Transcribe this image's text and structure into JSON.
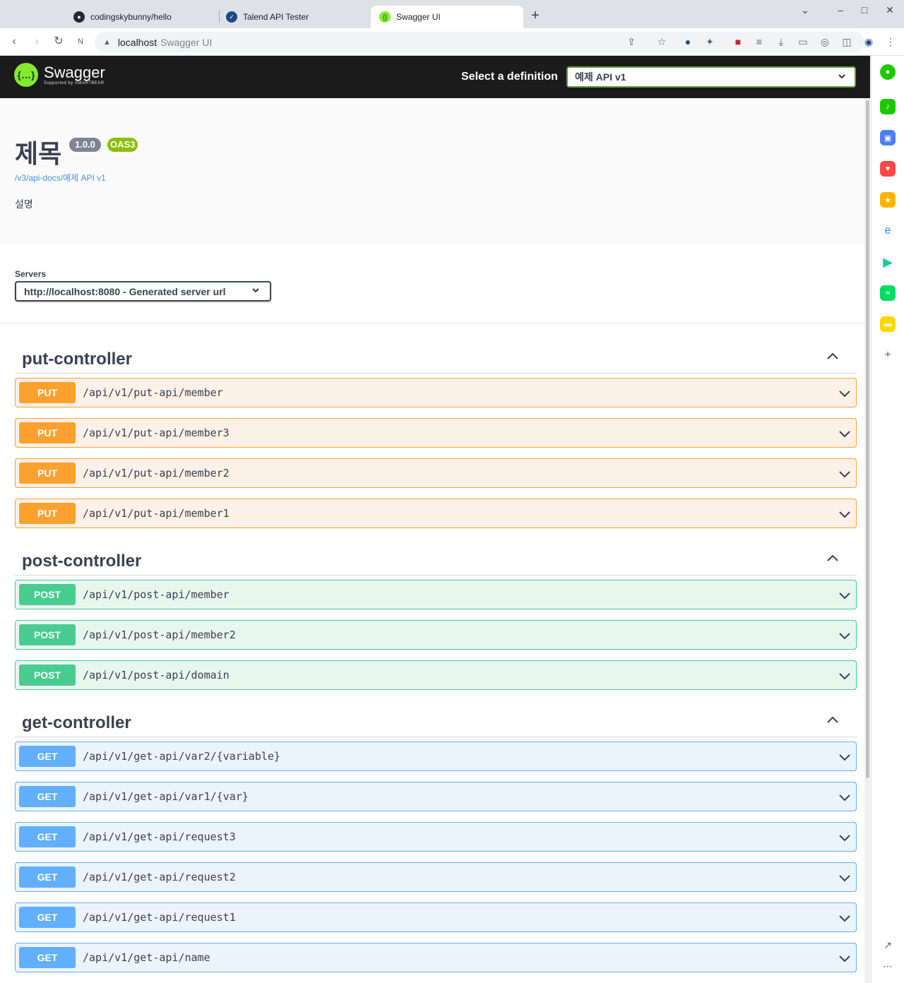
{
  "browser": {
    "tabs": [
      {
        "title": "codingskybunny/hello",
        "icon": "github-icon"
      },
      {
        "title": "Talend API Tester",
        "icon": "check-circle-icon"
      },
      {
        "title": "Swagger UI",
        "icon": "swagger-icon",
        "active": true
      }
    ],
    "new_tab": "+",
    "address": {
      "host": "localhost",
      "page_title": "Swagger UI"
    }
  },
  "swagger": {
    "logo_text": "Swagger",
    "logo_sub": "Supported by SMARTBEAR",
    "select_definition_label": "Select a definition",
    "selected_definition": "예제 API v1",
    "title": "제목",
    "version": "1.0.0",
    "oas": "OAS3",
    "url": "/v3/api-docs/예제 API v1",
    "description": "설명",
    "servers_label": "Servers",
    "server": "http://localhost:8080 - Generated server url",
    "colors": {
      "put": "#fca130",
      "post": "#49cc90",
      "get": "#61affe",
      "topbar": "#1b1b1b",
      "accent": "#85ea2d"
    }
  },
  "groups": [
    {
      "name": "put-controller",
      "ops": [
        {
          "method": "PUT",
          "path": "/api/v1/put-api/member"
        },
        {
          "method": "PUT",
          "path": "/api/v1/put-api/member3"
        },
        {
          "method": "PUT",
          "path": "/api/v1/put-api/member2"
        },
        {
          "method": "PUT",
          "path": "/api/v1/put-api/member1"
        }
      ]
    },
    {
      "name": "post-controller",
      "ops": [
        {
          "method": "POST",
          "path": "/api/v1/post-api/member"
        },
        {
          "method": "POST",
          "path": "/api/v1/post-api/member2"
        },
        {
          "method": "POST",
          "path": "/api/v1/post-api/domain"
        }
      ]
    },
    {
      "name": "get-controller",
      "ops": [
        {
          "method": "GET",
          "path": "/api/v1/get-api/var2/{variable}"
        },
        {
          "method": "GET",
          "path": "/api/v1/get-api/var1/{var}"
        },
        {
          "method": "GET",
          "path": "/api/v1/get-api/request3"
        },
        {
          "method": "GET",
          "path": "/api/v1/get-api/request2"
        },
        {
          "method": "GET",
          "path": "/api/v1/get-api/request1"
        },
        {
          "method": "GET",
          "path": "/api/v1/get-api/name"
        }
      ]
    }
  ]
}
